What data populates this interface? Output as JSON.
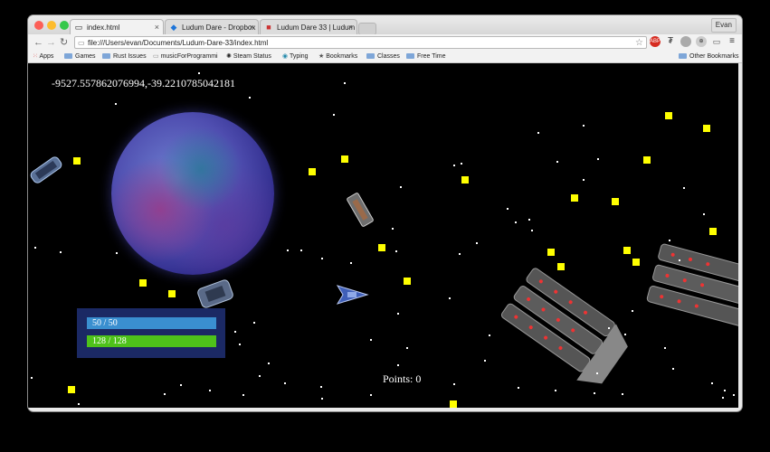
{
  "browser": {
    "tabs": [
      {
        "label": "index.html",
        "icon": "page-icon"
      },
      {
        "label": "Ludum Dare - Dropbox",
        "icon": "dropbox-icon"
      },
      {
        "label": "Ludum Dare 33 | Ludum D",
        "icon": "ludum-dare-icon"
      }
    ],
    "user": "Evan",
    "url": "file:///Users/evan/Documents/Ludum-Dare-33/index.html",
    "bookmarks": [
      "Apps",
      "Games",
      "Rust Issues",
      "musicForProgrammi",
      "Steam Status",
      "Typing",
      "Bookmarks",
      "Classes",
      "Free Time"
    ],
    "other_bookmarks": "Other Bookmarks",
    "extensions": [
      "ABP"
    ]
  },
  "game": {
    "coordinates": "-9527.557862076994,-39.2210785042181",
    "health": "50 / 50",
    "energy": "128 / 128",
    "points": "Points: 0",
    "colors": {
      "coin": "#ffff00",
      "hud_bg": "#1b2964",
      "health_bar": "#3a8fd0",
      "energy_bar": "#4ec21a"
    }
  }
}
